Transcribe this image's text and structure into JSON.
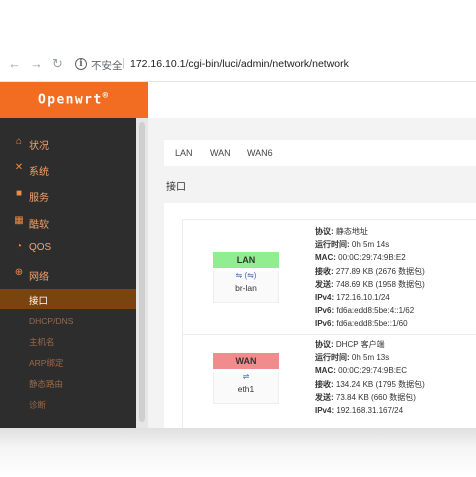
{
  "browser": {
    "back_icon": "arrow-left-icon",
    "forward_icon": "arrow-right-icon",
    "reload_icon": "reload-icon",
    "security_label": "不安全",
    "url": "172.16.10.1/cgi-bin/luci/admin/network/network"
  },
  "header": {
    "brand": "Openwrt",
    "brand_mark": "®"
  },
  "sidebar": {
    "items": [
      {
        "label": "状况",
        "icon": "home-icon"
      },
      {
        "label": "系统",
        "icon": "tools-icon"
      },
      {
        "label": "服务",
        "icon": "briefcase-icon"
      },
      {
        "label": "酷软",
        "icon": "calendar-icon"
      },
      {
        "label": "QOS",
        "icon": "gauge-icon"
      },
      {
        "label": "网络",
        "icon": "globe-icon"
      }
    ],
    "subitems": [
      {
        "label": "接口",
        "active": true
      },
      {
        "label": "DHCP/DNS"
      },
      {
        "label": "主机名"
      },
      {
        "label": "ARP绑定"
      },
      {
        "label": "静态路由"
      },
      {
        "label": "诊断"
      }
    ]
  },
  "tabs": [
    "LAN",
    "WAN",
    "WAN6"
  ],
  "section_title": "接口",
  "interfaces": [
    {
      "badge": "LAN",
      "device": "br-lan",
      "lines": [
        {
          "k": "协议:",
          "v": " 静态地址"
        },
        {
          "k": "运行时间:",
          "v": " 0h 5m 14s"
        },
        {
          "k": "MAC:",
          "v": " 00:0C:29:74:9B:E2"
        },
        {
          "k": "接收:",
          "v": " 277.89 KB (2676 数据包)"
        },
        {
          "k": "发送:",
          "v": " 748.69 KB (1958 数据包)"
        },
        {
          "k": "IPv4:",
          "v": " 172.16.10.1/24"
        },
        {
          "k": "IPv6:",
          "v": " fd6a:edd8:5be:4::1/62"
        },
        {
          "k": "IPv6:",
          "v": " fd6a:edd8:5be::1/60"
        }
      ]
    },
    {
      "badge": "WAN",
      "device": "eth1",
      "lines": [
        {
          "k": "协议:",
          "v": " DHCP 客户端"
        },
        {
          "k": "运行时间:",
          "v": " 0h 5m 13s"
        },
        {
          "k": "MAC:",
          "v": " 00:0C:29:74:9B:EC"
        },
        {
          "k": "接收:",
          "v": " 134.24 KB (1795 数据包)"
        },
        {
          "k": "发送:",
          "v": " 73.84 KB (660 数据包)"
        },
        {
          "k": "IPv4:",
          "v": " 192.168.31.167/24"
        }
      ]
    }
  ],
  "colors": {
    "header_orange": "#f26d21",
    "sidebar_bg": "#2d2d2d",
    "sidebar_text": "#f2a36d",
    "active_bg": "#7a4410",
    "lan_badge": "#90ee90",
    "wan_badge": "#f08c8c"
  }
}
